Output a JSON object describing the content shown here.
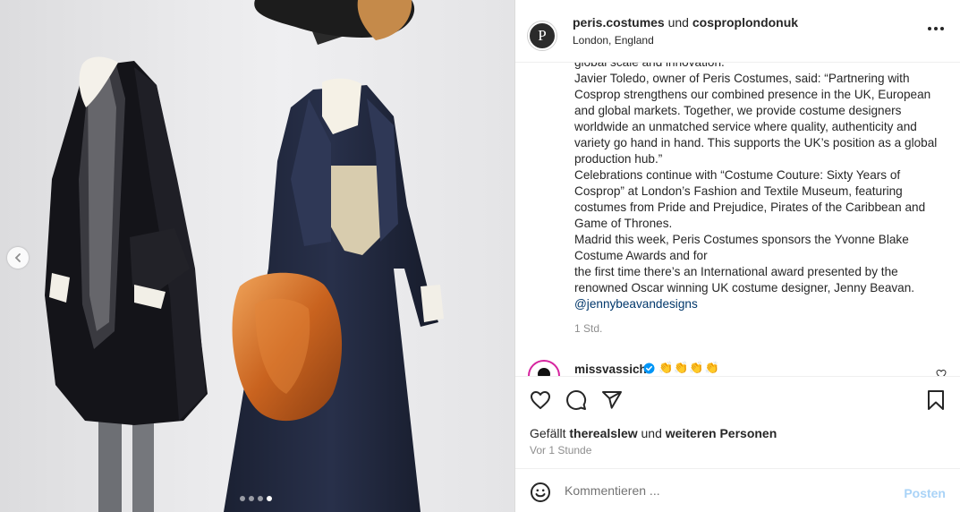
{
  "header": {
    "account_primary": "peris.costumes",
    "joiner": "und",
    "account_secondary": "cosproplondonuk",
    "location": "London, England",
    "avatar_letter": "P"
  },
  "caption": {
    "lines": [
      "global scale and innovation.”",
      "Javier Toledo, owner of Peris Costumes, said: “Partnering with Cosprop strengthens our combined presence in the UK, European and global markets. Together, we provide costume designers worldwide an unmatched service where quality, authenticity and variety go hand in hand. This supports the UK’s position as a global production hub.”",
      "Celebrations continue with “Costume Couture: Sixty Years of Cosprop” at London’s Fashion and Textile Museum, featuring costumes from Pride and Prejudice, Pirates of the Caribbean and Game of Thrones.",
      "Madrid this week, Peris Costumes sponsors the Yvonne Blake Costume Awards and for",
      "the first time there’s an International award presented by the renowned Oscar winning UK costume designer, Jenny Beavan."
    ],
    "mention": "@jennybeavandesigns",
    "time": "1 Std."
  },
  "comment": {
    "username": "missvassich",
    "text": "👏👏👏👏"
  },
  "likes": {
    "prefix": "Gefällt",
    "user": "therealslew",
    "middle": "und",
    "rest": "weiteren Personen"
  },
  "time_ago": "Vor 1 Stunde",
  "comment_box": {
    "placeholder": "Kommentieren ...",
    "post_label": "Posten"
  },
  "carousel": {
    "total": 4,
    "active_index": 4
  },
  "icons": [
    "chevron-left-icon",
    "more-icon",
    "heart-icon",
    "comment-icon",
    "share-icon",
    "bookmark-icon",
    "emoji-icon",
    "verified-icon"
  ],
  "colors": {
    "text": "#262626",
    "secondary": "#8e8e8e",
    "mention": "#00376b",
    "post_disabled": "#a9d3f7",
    "verified": "#0095f6"
  }
}
